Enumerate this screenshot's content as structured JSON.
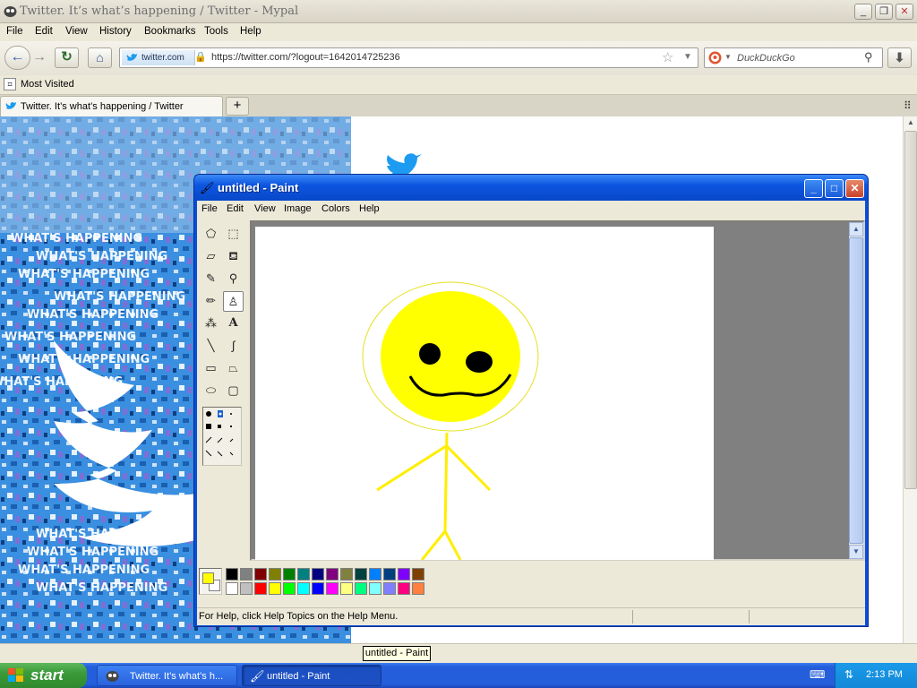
{
  "firefox": {
    "title": "Twitter. It’s what’s happening / Twitter - Mypal",
    "menu": [
      "File",
      "Edit",
      "View",
      "History",
      "Bookmarks",
      "Tools",
      "Help"
    ],
    "site_badge": "twitter.com",
    "url": "https://twitter.com/?logout=1642014725236",
    "search_placeholder": "DuckDuckGo",
    "bookmark_label": "Most Visited",
    "tab_label": "Twitter. It’s what’s happening / Twitter",
    "new_tab": "+"
  },
  "twitter_bg": {
    "text": "WHAT'S HAPPENING"
  },
  "paint": {
    "title": "untitled - Paint",
    "menu": [
      "File",
      "Edit",
      "View",
      "Image",
      "Colors",
      "Help"
    ],
    "status": "For Help, click Help Topics on the Help Menu.",
    "foreground_color": "#ffff00",
    "background_color": "#ffffff",
    "palette_row1": [
      "#000000",
      "#808080",
      "#800000",
      "#808000",
      "#008000",
      "#008080",
      "#000080",
      "#800080",
      "#808040",
      "#004040",
      "#0080ff",
      "#004080",
      "#8000ff",
      "#804000"
    ],
    "palette_row2": [
      "#ffffff",
      "#c0c0c0",
      "#ff0000",
      "#ffff00",
      "#00ff00",
      "#00ffff",
      "#0000ff",
      "#ff00ff",
      "#ffff80",
      "#00ff80",
      "#80ffff",
      "#8080ff",
      "#ff0080",
      "#ff8040"
    ],
    "tools": [
      "free-select-icon",
      "rect-select-icon",
      "eraser-icon",
      "fill-icon",
      "color-picker-icon",
      "magnifier-icon",
      "pencil-icon",
      "brush-icon",
      "airbrush-icon",
      "text-icon",
      "line-icon",
      "curve-icon",
      "rectangle-icon",
      "polygon-icon",
      "ellipse-icon",
      "rounded-rect-icon"
    ],
    "text_tool_glyph": "A"
  },
  "taskbar": {
    "start": "start",
    "items": [
      "Twitter. It’s what’s h...",
      "untitled - Paint"
    ],
    "tooltip": "untitled - Paint",
    "clock": "2:13 PM"
  }
}
